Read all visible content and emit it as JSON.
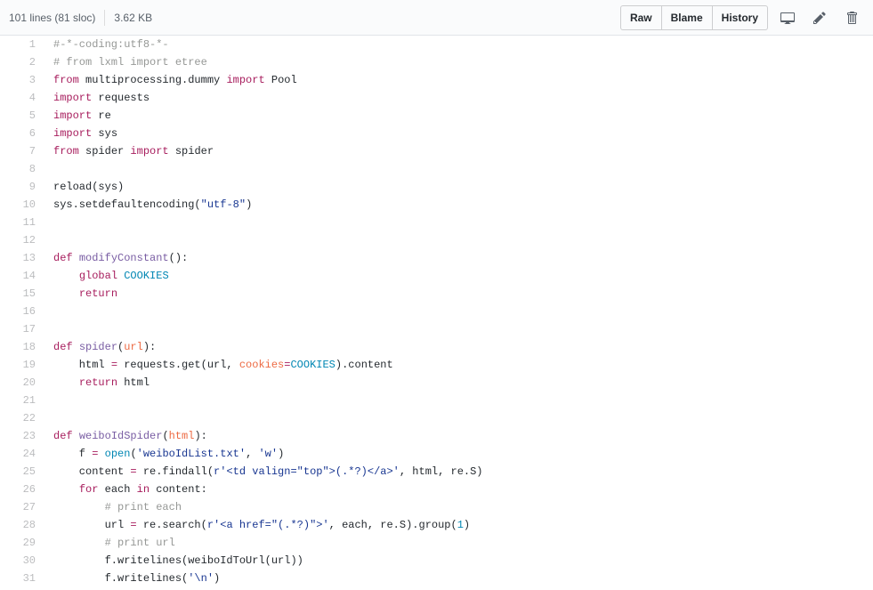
{
  "header": {
    "lines_label": "101 lines (81 sloc)",
    "size_label": "3.62 KB",
    "raw_label": "Raw",
    "blame_label": "Blame",
    "history_label": "History"
  },
  "code": {
    "lines": [
      {
        "n": 1,
        "tokens": [
          [
            "comment",
            "#-*-coding:utf8-*-"
          ]
        ]
      },
      {
        "n": 2,
        "tokens": [
          [
            "comment",
            "# from lxml import etree"
          ]
        ]
      },
      {
        "n": 3,
        "tokens": [
          [
            "keyword",
            "from"
          ],
          [
            "text",
            " multiprocessing.dummy "
          ],
          [
            "keyword",
            "import"
          ],
          [
            "text",
            " Pool"
          ]
        ]
      },
      {
        "n": 4,
        "tokens": [
          [
            "keyword",
            "import"
          ],
          [
            "text",
            " requests"
          ]
        ]
      },
      {
        "n": 5,
        "tokens": [
          [
            "keyword",
            "import"
          ],
          [
            "text",
            " re"
          ]
        ]
      },
      {
        "n": 6,
        "tokens": [
          [
            "keyword",
            "import"
          ],
          [
            "text",
            " sys"
          ]
        ]
      },
      {
        "n": 7,
        "tokens": [
          [
            "keyword",
            "from"
          ],
          [
            "text",
            " spider "
          ],
          [
            "keyword",
            "import"
          ],
          [
            "text",
            " spider"
          ]
        ]
      },
      {
        "n": 8,
        "tokens": []
      },
      {
        "n": 9,
        "tokens": [
          [
            "call",
            "reload"
          ],
          [
            "text",
            "(sys)"
          ]
        ]
      },
      {
        "n": 10,
        "tokens": [
          [
            "text",
            "sys.setdefaultencoding("
          ],
          [
            "string",
            "\"utf-8\""
          ],
          [
            "text",
            ")"
          ]
        ]
      },
      {
        "n": 11,
        "tokens": []
      },
      {
        "n": 12,
        "tokens": []
      },
      {
        "n": 13,
        "tokens": [
          [
            "keyword",
            "def"
          ],
          [
            "text",
            " "
          ],
          [
            "func",
            "modifyConstant"
          ],
          [
            "text",
            "():"
          ]
        ]
      },
      {
        "n": 14,
        "tokens": [
          [
            "text",
            "    "
          ],
          [
            "keyword",
            "global"
          ],
          [
            "text",
            " "
          ],
          [
            "const",
            "COOKIES"
          ]
        ]
      },
      {
        "n": 15,
        "tokens": [
          [
            "text",
            "    "
          ],
          [
            "keyword",
            "return"
          ]
        ]
      },
      {
        "n": 16,
        "tokens": []
      },
      {
        "n": 17,
        "tokens": []
      },
      {
        "n": 18,
        "tokens": [
          [
            "keyword",
            "def"
          ],
          [
            "text",
            " "
          ],
          [
            "func",
            "spider"
          ],
          [
            "text",
            "("
          ],
          [
            "param",
            "url"
          ],
          [
            "text",
            "):"
          ]
        ]
      },
      {
        "n": 19,
        "tokens": [
          [
            "text",
            "    html "
          ],
          [
            "keyword",
            "="
          ],
          [
            "text",
            " requests.get(url, "
          ],
          [
            "param",
            "cookies"
          ],
          [
            "keyword",
            "="
          ],
          [
            "const",
            "COOKIES"
          ],
          [
            "text",
            ").content"
          ]
        ]
      },
      {
        "n": 20,
        "tokens": [
          [
            "text",
            "    "
          ],
          [
            "keyword",
            "return"
          ],
          [
            "text",
            " html"
          ]
        ]
      },
      {
        "n": 21,
        "tokens": []
      },
      {
        "n": 22,
        "tokens": []
      },
      {
        "n": 23,
        "tokens": [
          [
            "keyword",
            "def"
          ],
          [
            "text",
            " "
          ],
          [
            "func",
            "weiboIdSpider"
          ],
          [
            "text",
            "("
          ],
          [
            "param",
            "html"
          ],
          [
            "text",
            "):"
          ]
        ]
      },
      {
        "n": 24,
        "tokens": [
          [
            "text",
            "    f "
          ],
          [
            "keyword",
            "="
          ],
          [
            "text",
            " "
          ],
          [
            "builtin",
            "open"
          ],
          [
            "text",
            "("
          ],
          [
            "string",
            "'weiboIdList.txt'"
          ],
          [
            "text",
            ", "
          ],
          [
            "string",
            "'w'"
          ],
          [
            "text",
            ")"
          ]
        ]
      },
      {
        "n": 25,
        "tokens": [
          [
            "text",
            "    content "
          ],
          [
            "keyword",
            "="
          ],
          [
            "text",
            " re.findall("
          ],
          [
            "string",
            "r'<td valign=\"top\">(.*?)</a>'"
          ],
          [
            "text",
            ", html, re.S)"
          ]
        ]
      },
      {
        "n": 26,
        "tokens": [
          [
            "text",
            "    "
          ],
          [
            "keyword",
            "for"
          ],
          [
            "text",
            " each "
          ],
          [
            "keyword",
            "in"
          ],
          [
            "text",
            " content:"
          ]
        ]
      },
      {
        "n": 27,
        "tokens": [
          [
            "text",
            "        "
          ],
          [
            "comment",
            "# print each"
          ]
        ]
      },
      {
        "n": 28,
        "tokens": [
          [
            "text",
            "        url "
          ],
          [
            "keyword",
            "="
          ],
          [
            "text",
            " re.search("
          ],
          [
            "string",
            "r'<a href=\"(.*?)\">'"
          ],
          [
            "text",
            ", each, re.S).group("
          ],
          [
            "number",
            "1"
          ],
          [
            "text",
            ")"
          ]
        ]
      },
      {
        "n": 29,
        "tokens": [
          [
            "text",
            "        "
          ],
          [
            "comment",
            "# print url"
          ]
        ]
      },
      {
        "n": 30,
        "tokens": [
          [
            "text",
            "        f.writelines(weiboIdToUrl(url))"
          ]
        ]
      },
      {
        "n": 31,
        "tokens": [
          [
            "text",
            "        f.writelines("
          ],
          [
            "string",
            "'\\n'"
          ],
          [
            "text",
            ")"
          ]
        ]
      }
    ]
  }
}
